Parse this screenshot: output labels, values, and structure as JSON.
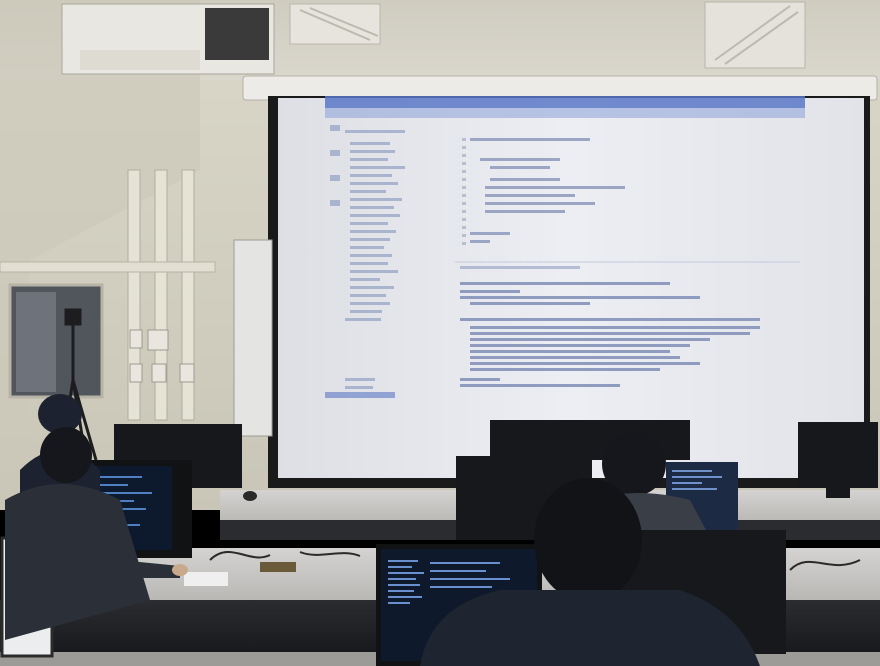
{
  "scene": {
    "description_tags": [
      "classroom",
      "projector-screen",
      "code-editor",
      "students",
      "monitors"
    ],
    "colors": {
      "wall": "#d9d6c9",
      "ceiling": "#cfcdc3",
      "screen": "#e8e9ee",
      "editor_bg": "#eceef3",
      "desk": "#cfcfcf",
      "monitor": "#1a1c20",
      "editor_blue": "#5a78c8"
    }
  }
}
